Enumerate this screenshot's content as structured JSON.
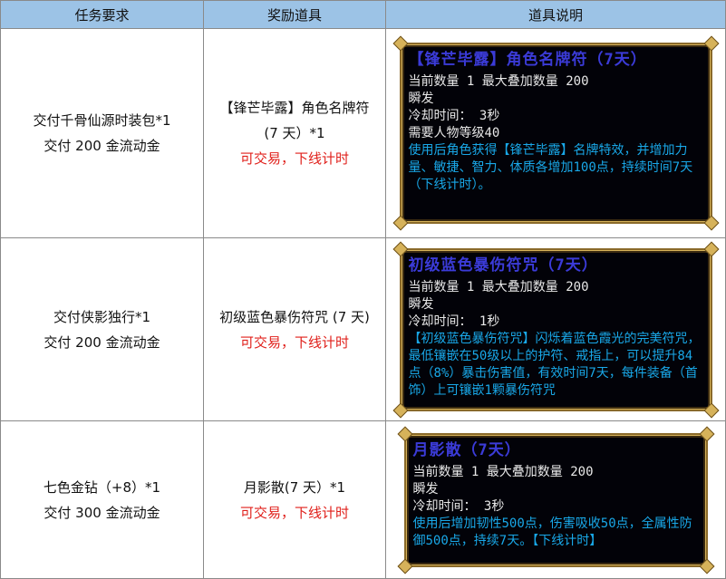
{
  "headers": {
    "task": "任务要求",
    "reward": "奖励道具",
    "desc": "道具说明"
  },
  "rows": [
    {
      "task_line1": "交付千骨仙源时装包*1",
      "task_line2": "交付 200 金流动金",
      "reward_line1": "【锋芒毕露】角色名牌符",
      "reward_line2": "(7 天）*1",
      "reward_note": "可交易，下线计时",
      "card": {
        "title": "【锋芒毕露】角色名牌符（7天）",
        "stats": [
          "当前数量 1 最大叠加数量 200",
          "瞬发",
          "冷却时间： 3秒",
          "需要人物等级40"
        ],
        "desc": "使用后角色获得【锋芒毕露】名牌特效，并增加力量、敏捷、智力、体质各增加100点，持续时间7天（下线计时）。"
      }
    },
    {
      "task_line1": "交付侠影独行*1",
      "task_line2": "交付 200 金流动金",
      "reward_line1": "初级蓝色暴伤符咒 (7 天)",
      "reward_line2": "",
      "reward_note": "可交易，下线计时",
      "card": {
        "title": "初级蓝色暴伤符咒（7天）",
        "stats": [
          "当前数量 1 最大叠加数量 200",
          "瞬发",
          "冷却时间： 1秒"
        ],
        "desc": "【初级蓝色暴伤符咒】闪烁着蓝色霞光的完美符咒，最低镶嵌在50级以上的护符、戒指上，可以提升84点（8%）暴击伤害值，有效时间7天，每件装备（首饰）上可镶嵌1颗暴伤符咒"
      }
    },
    {
      "task_line1": "七色金钻（+8）*1",
      "task_line2": "交付 300 金流动金",
      "reward_line1": "月影散(7 天）*1",
      "reward_line2": "",
      "reward_note": "可交易，下线计时",
      "card": {
        "title": "月影散（7天）",
        "stats": [
          "当前数量 1 最大叠加数量 200",
          "瞬发",
          "冷却时间： 3秒"
        ],
        "desc": "使用后增加韧性500点，伤害吸收50点，全属性防御500点，持续7天。【下线计时】"
      }
    }
  ],
  "colors": {
    "header_bg": "#9cc3e6",
    "note_red": "#e0201b",
    "card_title": "#3b3bd8",
    "card_desc": "#19a8e8"
  }
}
